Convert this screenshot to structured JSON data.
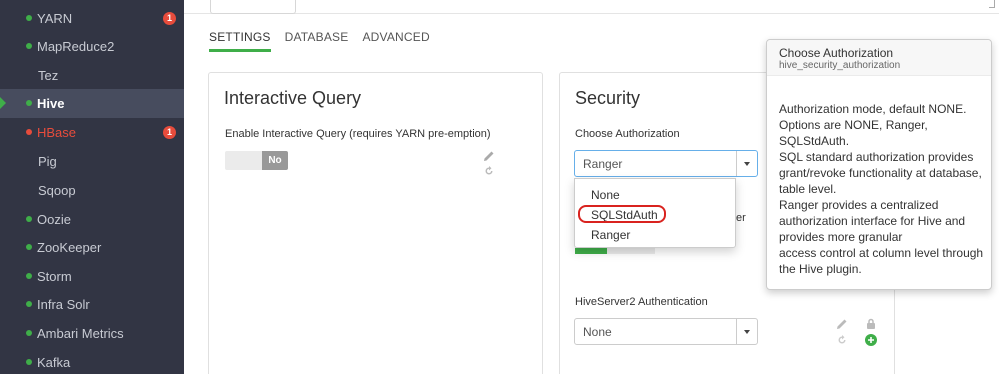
{
  "sidebar": {
    "items": [
      {
        "label": "YARN",
        "status": "green",
        "badge": "1"
      },
      {
        "label": "MapReduce2",
        "status": "green"
      },
      {
        "label": "Tez",
        "status": "none"
      },
      {
        "label": "Hive",
        "status": "green",
        "active": true
      },
      {
        "label": "HBase",
        "status": "red",
        "badge": "1"
      },
      {
        "label": "Pig",
        "status": "none"
      },
      {
        "label": "Sqoop",
        "status": "none"
      },
      {
        "label": "Oozie",
        "status": "green"
      },
      {
        "label": "ZooKeeper",
        "status": "green"
      },
      {
        "label": "Storm",
        "status": "green"
      },
      {
        "label": "Infra Solr",
        "status": "green"
      },
      {
        "label": "Ambari Metrics",
        "status": "green"
      },
      {
        "label": "Kafka",
        "status": "green"
      }
    ]
  },
  "tabs": [
    {
      "label": "SETTINGS",
      "active": true
    },
    {
      "label": "DATABASE"
    },
    {
      "label": "ADVANCED"
    }
  ],
  "interactive_query": {
    "title": "Interactive Query",
    "enable_label": "Enable Interactive Query (requires YARN pre-emption)",
    "toggle_value": "No"
  },
  "security": {
    "title": "Security",
    "auth_label": "Choose Authorization",
    "auth_value": "Ranger",
    "auth_options": [
      "None",
      "SQLStdAuth",
      "Ranger"
    ],
    "partial_label_fragment": "er",
    "hs2_auth_label": "HiveServer2 Authentication",
    "hs2_auth_value": "None"
  },
  "tooltip": {
    "title": "Choose Authorization",
    "subtitle": "hive_security_authorization",
    "body_lines": [
      "Authorization mode, default NONE.",
      "Options are NONE, Ranger,",
      "SQLStdAuth.",
      "SQL standard authorization provides",
      "grant/revoke functionality at database,",
      "table level.",
      "Ranger provides a centralized",
      "authorization interface for Hive and",
      "provides more granular",
      "access control at column level through",
      "the Hive plugin."
    ]
  },
  "colors": {
    "sidebar_bg": "#323544",
    "accent_green": "#3fae49",
    "alert_red": "#e74c3c",
    "highlight_ring": "#d9231f"
  }
}
